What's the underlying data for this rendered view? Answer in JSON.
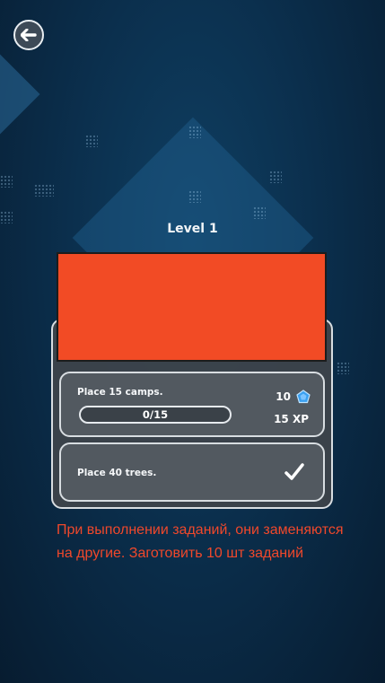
{
  "header": {
    "back_icon": "arrow-left-icon"
  },
  "level": {
    "title": "Level 1"
  },
  "tasks": [
    {
      "label": "Place 15 camps.",
      "progress_text": "0/15",
      "progress_fraction": 0,
      "reward_gems": "10",
      "gem_icon": "pentagon-gem-icon",
      "gem_color": "#3aa0f0",
      "reward_xp": "15 XP"
    },
    {
      "label": "Place 40 trees.",
      "status_icon": "checkmark-icon"
    }
  ],
  "banner": {
    "color": "#f24b25"
  },
  "annotation": {
    "text": "При выполнении заданий, они заменяются на другие. Заготовить 10 шт заданий",
    "color": "#f0482b"
  }
}
